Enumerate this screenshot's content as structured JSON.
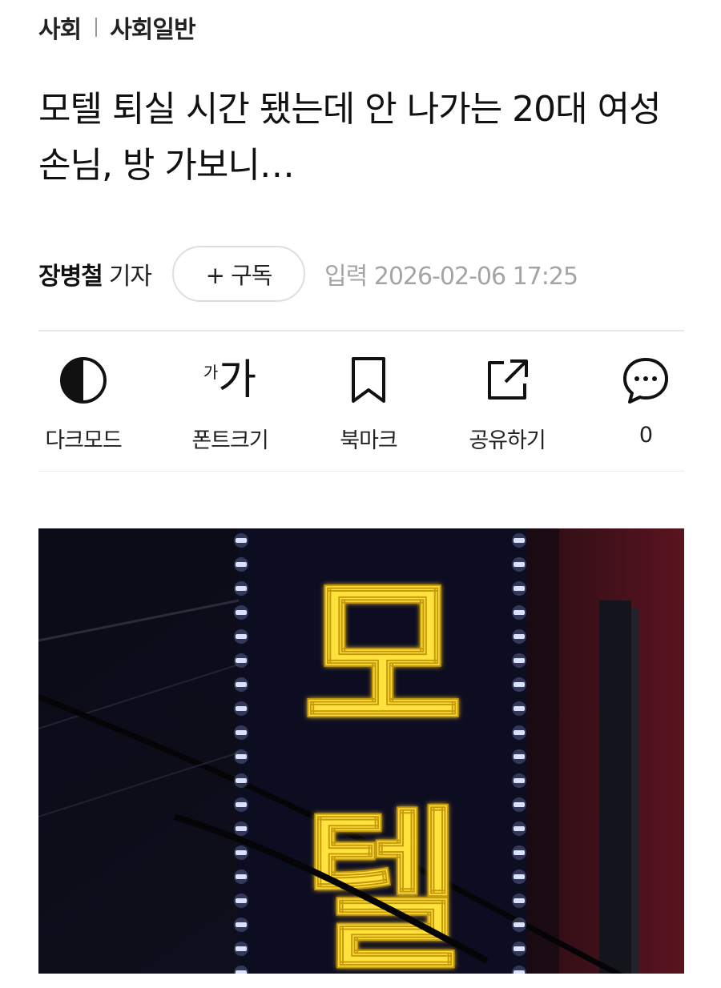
{
  "breadcrumb": {
    "section": "사회",
    "subsection": "사회일반"
  },
  "article": {
    "headline": "모텔 퇴실 시간 됐는데 안 나가는 20대 여성 손님, 방 가보니…",
    "author_name": "장병철",
    "author_role": "기자",
    "subscribe_label": "+ 구독",
    "published_label": "입력 2026-02-06 17:25"
  },
  "toolbar": {
    "items": [
      {
        "label": "다크모드",
        "icon": "dark-mode-icon"
      },
      {
        "label": "폰트크기",
        "icon": "font-size-icon",
        "icon_small": "가",
        "icon_big": "가"
      },
      {
        "label": "북마크",
        "icon": "bookmark-icon"
      },
      {
        "label": "공유하기",
        "icon": "share-icon"
      },
      {
        "label": "0",
        "icon": "comment-icon"
      }
    ]
  },
  "photo": {
    "sign_text": "모텔",
    "sign_color": "#ffe23a"
  },
  "colors": {
    "text": "#111111",
    "muted": "#a4a4a4",
    "divider": "#e6e6e6"
  }
}
